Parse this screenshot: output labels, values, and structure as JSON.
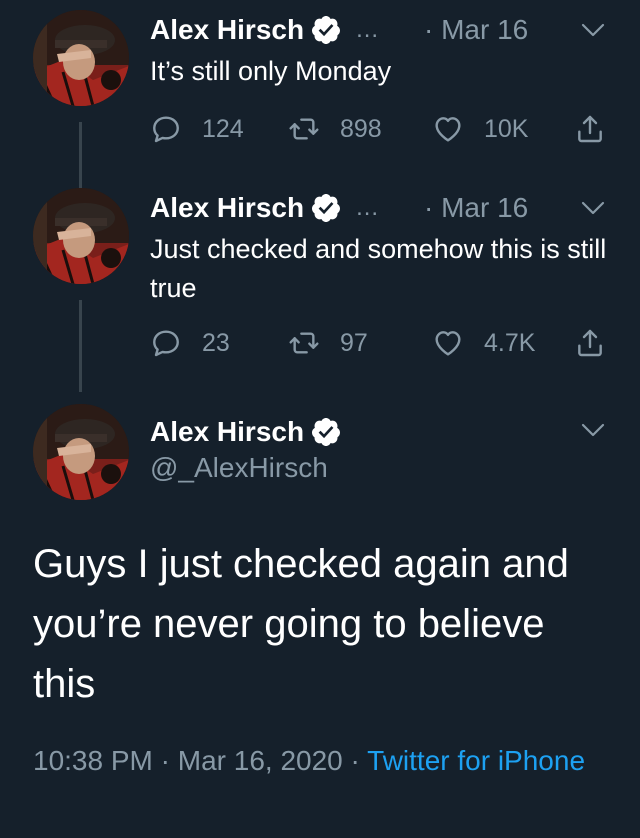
{
  "tweets": [
    {
      "author": "Alex Hirsch",
      "ellipsis": "...",
      "date": "· Mar 16",
      "text": "It’s still only Monday",
      "replies": "124",
      "retweets": "898",
      "likes": "10K"
    },
    {
      "author": "Alex Hirsch",
      "ellipsis": "...",
      "date": "· Mar 16",
      "text": "Just checked and somehow this is still true",
      "replies": "23",
      "retweets": "97",
      "likes": "4.7K"
    }
  ],
  "main_tweet": {
    "author": "Alex Hirsch",
    "handle": "@_AlexHirsch",
    "text": "Guys I just checked again and you’re never going to believe this",
    "time": "10:38 PM",
    "separator": " · ",
    "date": "Mar 16, 2020",
    "source": "Twitter for iPhone"
  },
  "colors": {
    "background": "#15202b",
    "text_primary": "#ffffff",
    "text_secondary": "#8899a6",
    "link": "#1da1f2",
    "thread_line": "#38444d"
  },
  "icons": [
    "verified-badge-icon",
    "chevron-down-icon",
    "reply-icon",
    "retweet-icon",
    "like-icon",
    "share-icon"
  ]
}
